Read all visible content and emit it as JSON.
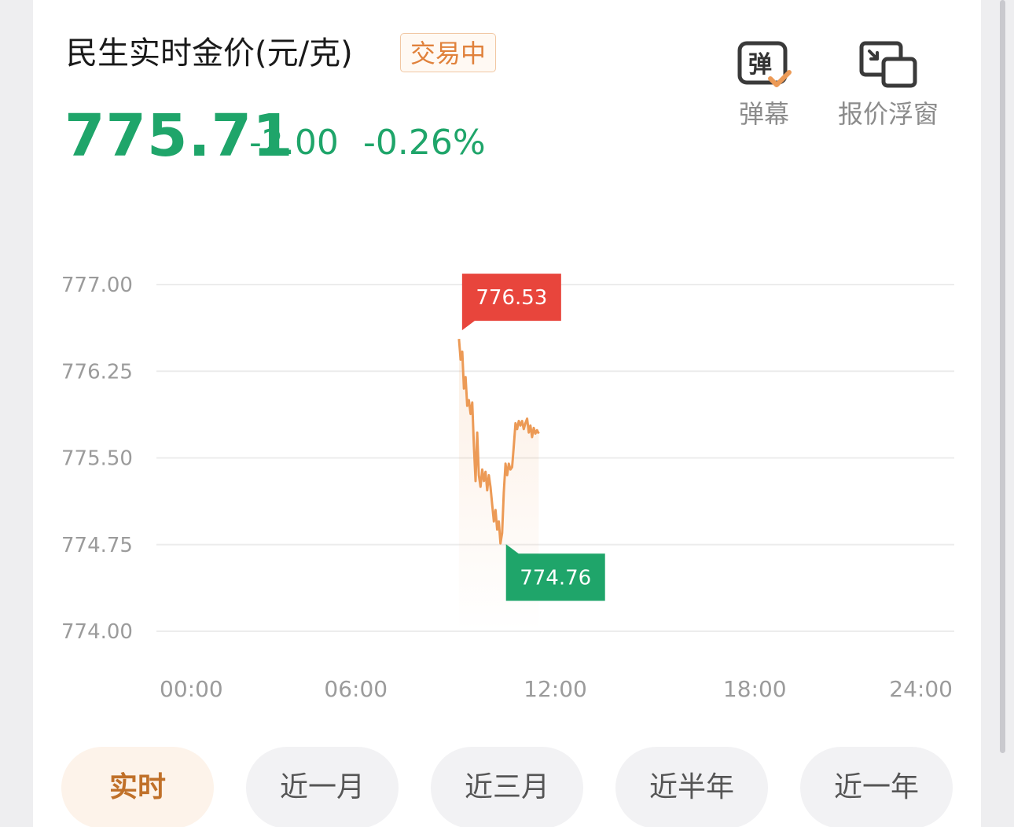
{
  "header": {
    "title": "民生实时金价(元/克)",
    "status_badge": "交易中",
    "price": "775.71",
    "change": "-2.00",
    "change_percent": "-0.26%"
  },
  "toolbar": {
    "danmaku_icon_text": "弹",
    "danmaku_label": "弹幕",
    "float_label": "报价浮窗"
  },
  "colors": {
    "down": "#1fa56a",
    "up": "#e8453c",
    "line": "#ec9a56",
    "accent": "#e0813b"
  },
  "chart_data": {
    "type": "line",
    "y_ticks": [
      "777.00",
      "776.25",
      "775.50",
      "774.75",
      "774.00"
    ],
    "ylim": [
      774.0,
      777.0
    ],
    "x_ticks": [
      "00:00",
      "06:00",
      "12:00",
      "18:00",
      "24:00"
    ],
    "x_range_hours": [
      0,
      24
    ],
    "max_label": "776.53",
    "min_label": "774.76",
    "series": [
      {
        "x": [
          9.1,
          9.15,
          9.2,
          9.25,
          9.3,
          9.35,
          9.4,
          9.45,
          9.5,
          9.55,
          9.6,
          9.65,
          9.7,
          9.75,
          9.8,
          9.85,
          9.9,
          9.95,
          10.0,
          10.05,
          10.1,
          10.15,
          10.2,
          10.25,
          10.3,
          10.35,
          10.4,
          10.45,
          10.5,
          10.55,
          10.6,
          10.65,
          10.7,
          10.75,
          10.8,
          10.85,
          10.9,
          10.95,
          11.0,
          11.05,
          11.1,
          11.15,
          11.2,
          11.25,
          11.3,
          11.35,
          11.4,
          11.45,
          11.5
        ],
        "y": [
          776.53,
          776.35,
          776.42,
          776.1,
          776.2,
          775.95,
          776.0,
          775.88,
          775.98,
          775.6,
          775.3,
          775.72,
          775.35,
          775.25,
          775.4,
          775.3,
          775.38,
          775.22,
          775.35,
          775.25,
          775.1,
          774.95,
          775.05,
          774.88,
          774.95,
          774.76,
          774.85,
          775.2,
          775.45,
          775.35,
          775.45,
          775.4,
          775.42,
          775.6,
          775.8,
          775.75,
          775.82,
          775.78,
          775.82,
          775.75,
          775.8,
          775.84,
          775.72,
          775.78,
          775.68,
          775.76,
          775.71,
          775.74,
          775.71
        ]
      }
    ]
  },
  "tabs": [
    "实时",
    "近一月",
    "近三月",
    "近半年",
    "近一年"
  ],
  "active_tab": 0
}
